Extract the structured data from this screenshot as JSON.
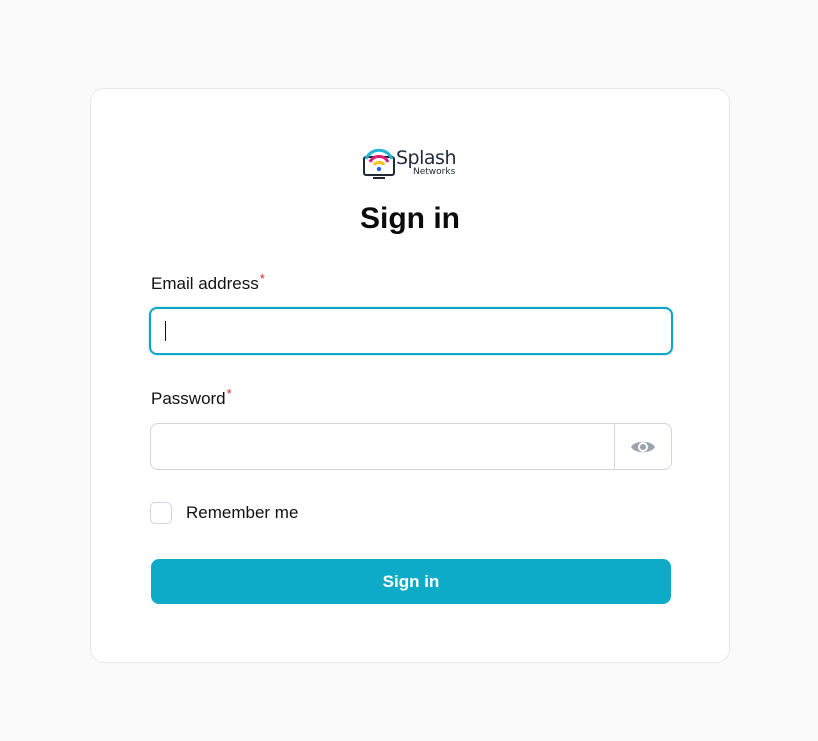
{
  "brand": {
    "name": "Splash",
    "subname": "Networks",
    "accent": "#0eabc9"
  },
  "form": {
    "title": "Sign in",
    "email": {
      "label": "Email address",
      "required_marker": "*",
      "value": ""
    },
    "password": {
      "label": "Password",
      "required_marker": "*",
      "value": "",
      "reveal_icon": "eye-icon"
    },
    "remember": {
      "label": "Remember me",
      "checked": false
    },
    "submit_label": "Sign in"
  }
}
